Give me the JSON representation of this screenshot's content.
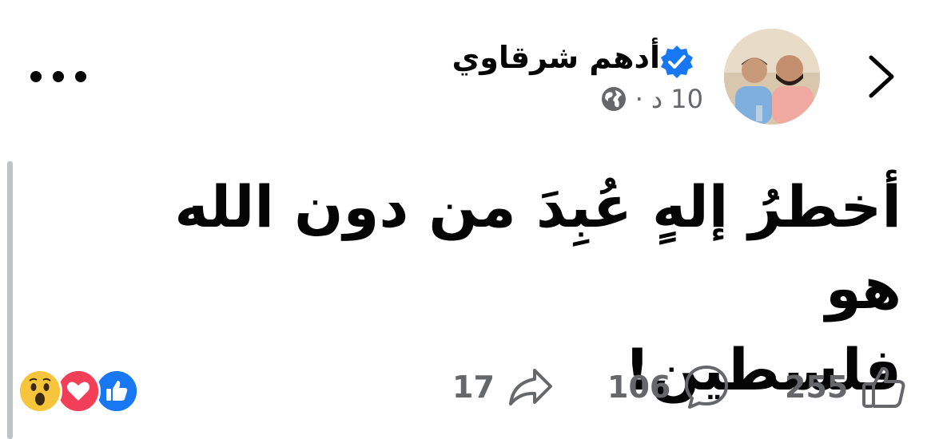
{
  "post": {
    "author": "أدهم  شرقاوي",
    "verified": true,
    "time": "10 د",
    "separator": "·",
    "privacy_icon": "globe-icon",
    "text_line1": "أخطرُ إلهٍ عُبِدَ من دون الله هو",
    "text_line2": "فلسطين!"
  },
  "stats": {
    "reaction_icons": [
      "like-icon",
      "love-icon",
      "wow-icon"
    ],
    "likes": "255",
    "comments": "106",
    "shares": "17"
  },
  "colors": {
    "accent": "#1877f2",
    "love": "#f33e58",
    "wow": "#f7b928",
    "secondary_text": "#65676b"
  }
}
